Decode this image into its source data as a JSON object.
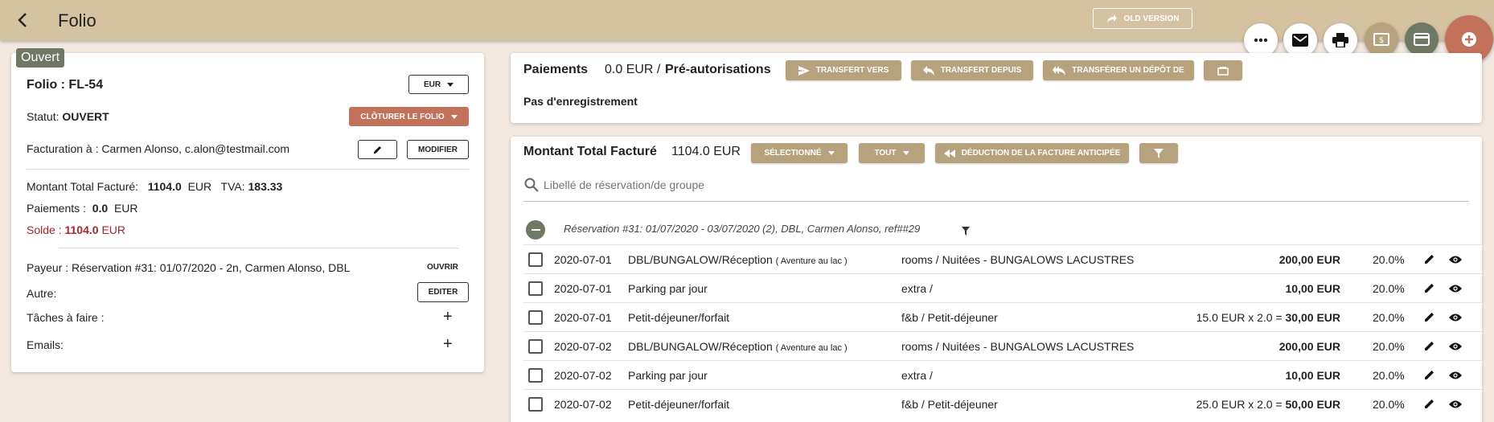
{
  "header": {
    "title": "Folio",
    "old_version": "OLD VERSION"
  },
  "left": {
    "status_badge": "Ouvert",
    "folio_label": "Folio : FL-54",
    "currency": "EUR",
    "status_label": "Statut:",
    "status_value": "OUVERT",
    "close_folio": "CLÔTURER LE FOLIO",
    "billing_label": "Facturation à :",
    "billing_value": "Carmen Alonso, c.alon@testmail.com",
    "modify": "MODIFIER",
    "total_label": "Montant Total Facturé:",
    "total_value": "1104.0",
    "total_currency": "EUR",
    "tva_label": "TVA:",
    "tva_value": "183.33",
    "payments_label": "Paiements :",
    "payments_value": "0.0",
    "payments_currency": "EUR",
    "solde_label": "Solde :",
    "solde_value": "1104.0",
    "solde_currency": "EUR",
    "payer": "Payeur : Réservation #31: 01/07/2020 - 2n, Carmen Alonso, DBL",
    "open": "OUVRIR",
    "other_label": "Autre:",
    "edit": "EDITER",
    "tasks_label": "Tâches à faire :",
    "emails_label": "Emails:"
  },
  "payments": {
    "title": "Paiements",
    "amount": "0.0 EUR /",
    "preauth": "Pré-autorisations",
    "transfer_to": "TRANSFERT VERS",
    "transfer_from": "TRANSFERT DEPUIS",
    "transfer_deposit": "TRANSFÉRER UN DÉPÔT DE",
    "empty": "Pas d'enregistrement"
  },
  "billed": {
    "title": "Montant Total Facturé",
    "amount": "1104.0 EUR",
    "selected": "SÉLECTIONNÉ",
    "all": "TOUT",
    "advance": "DÉDUCTION DE LA FACTURE ANTICIPÉE",
    "search_placeholder": "Libellé de réservation/de groupe",
    "group_label": "Réservation #31: 01/07/2020 - 03/07/2020 (2), DBL, Carmen Alonso, ref##29",
    "rows": [
      {
        "date": "2020-07-01",
        "label": "DBL/BUNGALOW/Réception",
        "tag": "( Aventure au lac )",
        "category": "rooms / Nuitées - BUNGALOWS LACUSTRES",
        "formula": "",
        "amount": "200,00 EUR",
        "tax": "20.0%"
      },
      {
        "date": "2020-07-01",
        "label": "Parking par jour",
        "tag": "",
        "category": "extra /",
        "formula": "",
        "amount": "10,00 EUR",
        "tax": "20.0%"
      },
      {
        "date": "2020-07-01",
        "label": "Petit-déjeuner/forfait",
        "tag": "",
        "category": "f&b / Petit-déjeuner",
        "formula": "15.0 EUR x 2.0 = ",
        "amount": "30,00 EUR",
        "tax": "20.0%"
      },
      {
        "date": "2020-07-02",
        "label": "DBL/BUNGALOW/Réception",
        "tag": "( Aventure au lac )",
        "category": "rooms / Nuitées - BUNGALOWS LACUSTRES",
        "formula": "",
        "amount": "200,00 EUR",
        "tax": "20.0%"
      },
      {
        "date": "2020-07-02",
        "label": "Parking par jour",
        "tag": "",
        "category": "extra /",
        "formula": "",
        "amount": "10,00 EUR",
        "tax": "20.0%"
      },
      {
        "date": "2020-07-02",
        "label": "Petit-déjeuner/forfait",
        "tag": "",
        "category": "f&b / Petit-déjeuner",
        "formula": "25.0 EUR x 2.0 = ",
        "amount": "50,00 EUR",
        "tax": "20.0%"
      }
    ]
  },
  "colors": {
    "header": "#d4c2a0",
    "accent": "#b6a27c",
    "danger": "#c2715a",
    "olive": "#6f7864",
    "solde": "#a0282b"
  },
  "icons": [
    "back-arrow-icon",
    "share-icon",
    "more-icon",
    "mail-icon",
    "print-icon",
    "cash-icon",
    "card-icon",
    "plus-icon",
    "pencil-icon",
    "eye-icon",
    "filter-icon",
    "search-icon",
    "send-icon",
    "reply-icon",
    "reply-all-icon",
    "bed-icon",
    "rewind-icon",
    "minus-icon"
  ]
}
